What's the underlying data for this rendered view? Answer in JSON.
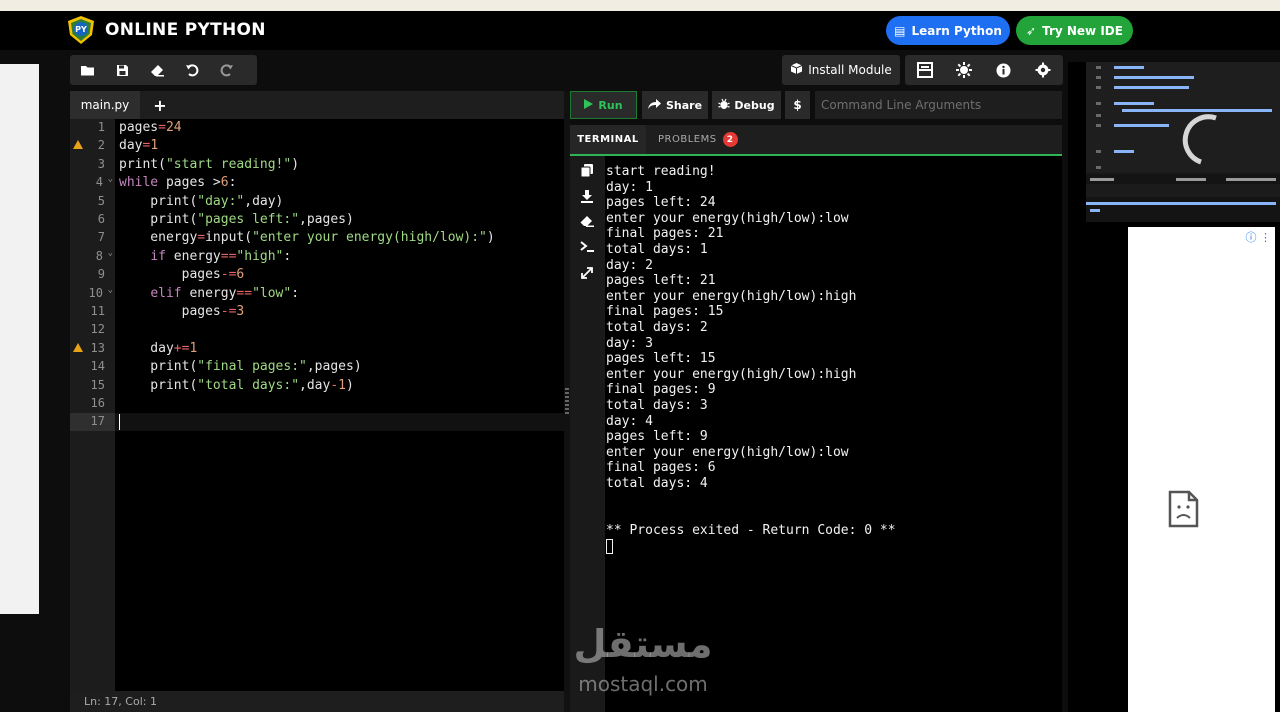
{
  "header": {
    "brand": "ONLINE PYTHON",
    "learn_label": "Learn Python",
    "try_label": "Try New IDE",
    "accent_blue": "#1f6ff2",
    "accent_green": "#22a43a"
  },
  "toolbar": {
    "icons": [
      "folder-open-icon",
      "save-icon",
      "eraser-icon",
      "undo-icon",
      "redo-icon"
    ],
    "install_label": "Install Module",
    "right_icons": [
      "layout-icon",
      "gear-sun-icon",
      "info-icon",
      "settings-icon"
    ]
  },
  "editor": {
    "tab_name": "main.py",
    "add_tab": "+",
    "status": "Ln: 17,  Col: 1",
    "lines": [
      "pages=24",
      "day=1",
      "print(\"start reading!\")",
      "while pages >6:",
      "    print(\"day:\",day)",
      "    print(\"pages left:\",pages)",
      "    energy=input(\"enter your energy(high/low):\")",
      "    if energy==\"high\":",
      "        pages-=6",
      "    elif energy==\"low\":",
      "        pages-=3",
      "",
      "    day+=1",
      "    print(\"final pages:\",pages)",
      "    print(\"total days:\",day-1)",
      "",
      ""
    ],
    "line_numbers": [
      "1",
      "2",
      "3",
      "4",
      "5",
      "6",
      "7",
      "8",
      "9",
      "10",
      "11",
      "12",
      "13",
      "14",
      "15",
      "16",
      "17"
    ]
  },
  "runbar": {
    "run_label": "Run",
    "share_label": "Share",
    "debug_label": "Debug",
    "dollar_label": "$",
    "cmd_placeholder": "Command Line Arguments"
  },
  "terminal_tabs": {
    "terminal": "TERMINAL",
    "problems": "PROBLEMS",
    "problems_count": "2"
  },
  "terminal": {
    "lines": [
      "start reading!",
      "day: 1",
      "pages left: 24",
      "enter your energy(high/low):low",
      "final pages: 21",
      "total days: 1",
      "day: 2",
      "pages left: 21",
      "enter your energy(high/low):high",
      "final pages: 15",
      "total days: 2",
      "day: 3",
      "pages left: 15",
      "enter your energy(high/low):high",
      "final pages: 9",
      "total days: 3",
      "day: 4",
      "pages left: 9",
      "enter your energy(high/low):low",
      "final pages: 6",
      "total days: 4"
    ],
    "exit_line": "** Process exited - Return Code: 0 **"
  },
  "watermark": {
    "arabic": "مستقل",
    "latin": "mostaql.com"
  }
}
